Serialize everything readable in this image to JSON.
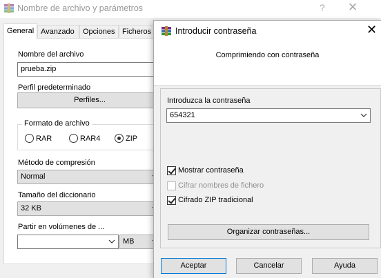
{
  "background_dialog": {
    "title": "Nombre de archivo y parámetros",
    "help_glyph": "?",
    "close_glyph": "✕",
    "tabs": [
      "General",
      "Avanzado",
      "Opciones",
      "Ficheros"
    ],
    "active_tab": "General",
    "filename": {
      "label": "Nombre del archivo",
      "value": "prueba.zip"
    },
    "profile": {
      "label": "Perfil predeterminado",
      "button": "Perfiles..."
    },
    "format": {
      "legend": "Formato de archivo",
      "options": [
        "RAR",
        "RAR4",
        "ZIP"
      ],
      "selected": "ZIP"
    },
    "compression_method": {
      "label": "Método de compresión",
      "value": "Normal"
    },
    "dictionary_size": {
      "label": "Tamaño del diccionario",
      "value": "32 KB"
    },
    "split_volumes": {
      "label": "Partir en volúmenes de ...",
      "value": "",
      "unit": "MB"
    }
  },
  "password_dialog": {
    "title": "Introducir contraseña",
    "close_glyph": "✕",
    "caption": "Comprimiendo con contraseña",
    "password_label": "Introduzca la contraseña",
    "password_value": "654321",
    "checkboxes": {
      "show_password": {
        "label": "Mostrar contraseña",
        "checked": true,
        "enabled": true
      },
      "encrypt_filenames": {
        "label": "Cifrar nombres de fichero",
        "checked": false,
        "enabled": false
      },
      "zip_legacy": {
        "label": "Cifrado ZIP tradicional",
        "checked": true,
        "enabled": true
      }
    },
    "organize_button": "Organizar contraseñas...",
    "buttons": {
      "ok": "Aceptar",
      "cancel": "Cancelar",
      "help": "Ayuda"
    }
  }
}
